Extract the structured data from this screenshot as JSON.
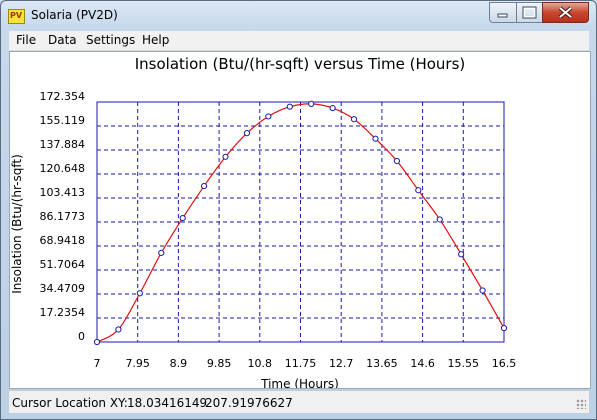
{
  "window": {
    "title": "Solaria (PV2D)",
    "app_icon_text": "PV"
  },
  "menu": [
    "File",
    "Data",
    "Settings",
    "Help"
  ],
  "status": {
    "label": "Cursor Location XY:",
    "x": "18.03416149",
    "y": "207.91976627"
  },
  "chart_data": {
    "type": "line",
    "title": "Insolation (Btu/(hr-sqft) versus Time (Hours)",
    "xlabel": "Time (Hours)",
    "ylabel": "Insolation (Btu/(hr-sqft)",
    "xlim": [
      7,
      16.5
    ],
    "ylim": [
      0,
      172.354
    ],
    "x_ticks": [
      "7",
      "7.95",
      "8.9",
      "9.85",
      "10.8",
      "11.75",
      "12.7",
      "13.65",
      "14.6",
      "15.55",
      "16.5"
    ],
    "y_ticks": [
      "0",
      "17.2354",
      "34.4709",
      "51.7064",
      "68.9418",
      "86.1773",
      "103.413",
      "120.648",
      "137.884",
      "155.119",
      "172.354"
    ],
    "grid": true,
    "line_color": "#e01010",
    "marker_color": "#1a1aa8",
    "frame_color": "#1a1aa8",
    "series": [
      {
        "values_x": [
          7,
          7.5,
          8,
          8.5,
          9,
          9.5,
          10,
          10.5,
          11,
          11.5,
          12,
          12.5,
          13,
          13.5,
          14,
          14.5,
          15,
          15.5,
          16,
          16.5
        ],
        "values_y": [
          0,
          9,
          35,
          64,
          89,
          112,
          133,
          150,
          162,
          169,
          171,
          168,
          160,
          146,
          130,
          109,
          88,
          63,
          37,
          10
        ]
      }
    ]
  }
}
